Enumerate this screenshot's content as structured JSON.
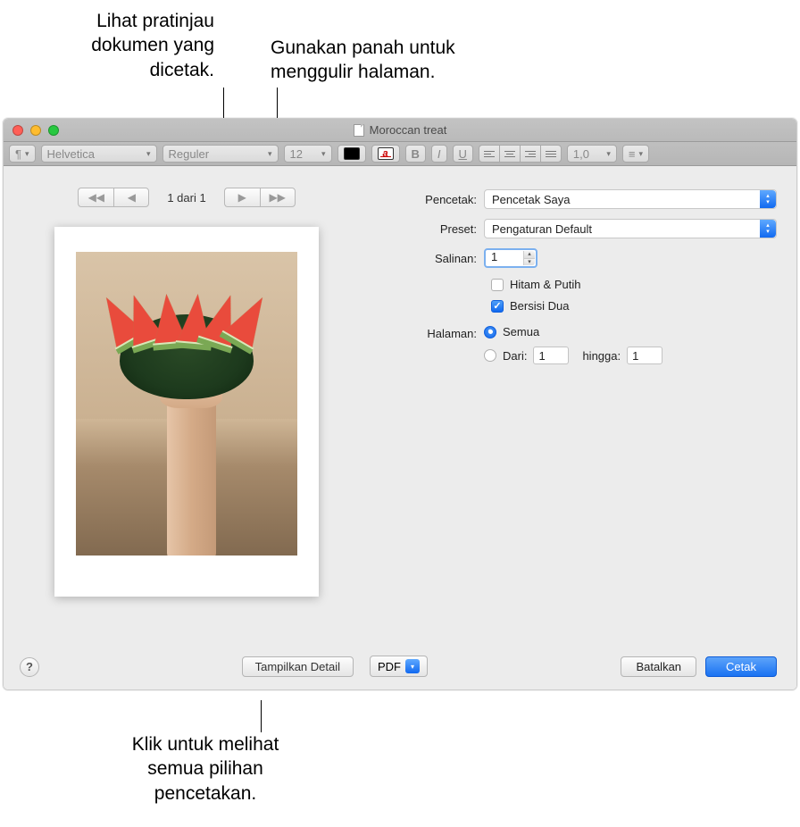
{
  "callouts": {
    "preview": "Lihat pratinjau\ndokumen yang\ndicetak.",
    "arrows": "Gunakan panah untuk\nmenggulir halaman.",
    "details": "Klik untuk melihat\nsemua pilihan\npencetakan."
  },
  "window": {
    "title": "Moroccan treat"
  },
  "toolbar": {
    "font": "Helvetica",
    "style": "Reguler",
    "size": "12",
    "linespacing": "1,0"
  },
  "nav": {
    "page_indicator": "1 dari 1"
  },
  "buttons": {
    "show_details": "Tampilkan Detail",
    "pdf": "PDF",
    "cancel": "Batalkan",
    "print": "Cetak",
    "help": "?"
  },
  "form": {
    "printer_label": "Pencetak:",
    "printer_value": "Pencetak Saya",
    "preset_label": "Preset:",
    "preset_value": "Pengaturan Default",
    "copies_label": "Salinan:",
    "copies_value": "1",
    "bw_label": "Hitam & Putih",
    "twosided_label": "Bersisi Dua",
    "pages_label": "Halaman:",
    "all_label": "Semua",
    "from_label": "Dari:",
    "from_value": "1",
    "to_label": "hingga:",
    "to_value": "1"
  }
}
